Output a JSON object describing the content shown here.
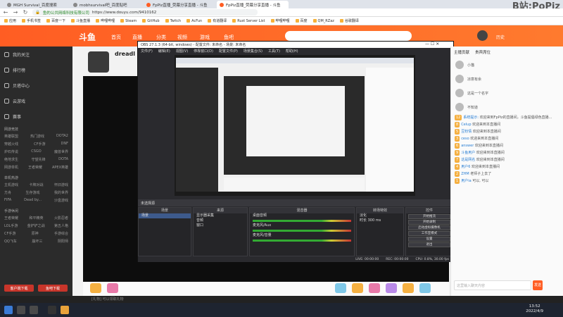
{
  "tabs": [
    {
      "label": "MGH Survival_百度搜索"
    },
    {
      "label": "mobhsurvival吧_百度贴吧"
    },
    {
      "label": "FpPiz直播_荧幕分享直播 - 斗鱼"
    },
    {
      "label": "FpPiz直播_荧幕分享直播 - 斗鱼"
    }
  ],
  "watermark": "B站:PoPiz",
  "address": {
    "lock": "🔒",
    "site_label": "鱼的公共网络科技有限公司",
    "url": "https://www.douyu.com/9410162"
  },
  "bookmarks": [
    "应用",
    "手机书签",
    "百度一下",
    "斗鱼直播",
    "哔哩哔哩",
    "Steam",
    "GitHub",
    "Twitch",
    "AcFun",
    "有道翻译",
    "Rust Server List",
    "哔哩哔哩",
    "百度",
    "QM_RZaz",
    "谷歌翻译"
  ],
  "douyu": {
    "logo": "斗鱼",
    "nav": [
      "首页",
      "直播",
      "分类",
      "视频",
      "游戏",
      "鱼吧"
    ],
    "history": "历史"
  },
  "sidebar": {
    "items": [
      {
        "label": "我的关注"
      },
      {
        "label": "排行榜"
      },
      {
        "label": "贝塔中心"
      },
      {
        "label": "云游戏"
      },
      {
        "label": "赛事"
      }
    ],
    "sections": [
      {
        "title": "网游竞技",
        "rows": [
          [
            "英雄联盟",
            "热门游戏",
            "DOTA2"
          ],
          [
            "穿越火线",
            "CF手游",
            "DNF"
          ],
          [
            "炉石传说",
            "CSGO",
            "魔兽世界"
          ],
          [
            "绝地求生",
            "守望先锋",
            "DOTA"
          ],
          [
            "网游单机",
            "王者荣耀",
            "APEX英雄"
          ]
        ]
      },
      {
        "title": "单机热游",
        "rows": [
          [
            "主机游戏",
            "卡牌对战",
            "怀旧游戏"
          ],
          [
            "方舟",
            "生存游戏",
            "我的世界"
          ],
          [
            "FIFA",
            "Dead by...",
            "沙盒游戏"
          ]
        ]
      },
      {
        "title": "手游休闲",
        "rows": [
          [
            "王者荣耀",
            "和平精英",
            "火影忍者"
          ],
          [
            "LOL手游",
            "金铲铲之战",
            "第五人格"
          ],
          [
            "CF手游",
            "原神",
            "手游综合"
          ],
          [
            "QQ飞车",
            "崩坏三",
            "阴阳师"
          ]
        ]
      }
    ],
    "btn_left": "客户端下载",
    "btn_right": "鱼吧下载"
  },
  "room": {
    "anchor_name": "dreadl",
    "gift_tip": "[礼物] 可以领取礼物"
  },
  "obs": {
    "title": "OBS 27.1.3 (64-bit, windows) - 配置文件: 未命名 - 场景: 未命名",
    "menu": [
      "文件(F)",
      "编辑(E)",
      "视图(V)",
      "停靠窗口(D)",
      "配置文件(P)",
      "场景集合(S)",
      "工具(T)",
      "帮助(H)"
    ],
    "scene_bar": "未选择源",
    "panels": [
      {
        "header": "场景",
        "lines": [
          "场景"
        ]
      },
      {
        "header": "来源",
        "lines": [
          "显示器采集",
          "音频",
          "窗口"
        ]
      },
      {
        "header": "混音器",
        "lines": [
          "桌面音频",
          "麦克风/Aux",
          "麦克风/音量"
        ]
      },
      {
        "header": "转场特效",
        "lines": [
          "淡化",
          "时长  300 ms"
        ]
      },
      {
        "header": "控件",
        "lines": [
          "开始推流",
          "开始录制",
          "启动虚拟摄像机",
          "工作室模式",
          "设置",
          "退出"
        ]
      }
    ],
    "status": [
      "LIVE: 00:00:00",
      "REC: 00:00:00",
      "CPU: 0.8%, 30.00 fps"
    ]
  },
  "chat": {
    "tabs": [
      "主播贡献",
      "贵宾席位"
    ],
    "ranks": [
      {
        "name": "小猫"
      },
      {
        "name": "凉意有余"
      },
      {
        "name": "这是一个名字"
      },
      {
        "name": "不知道"
      }
    ],
    "messages": [
      {
        "lvl": "12",
        "user": "系统提示:",
        "text": "欢迎来到FpPiz的直播间，斗鱼提倡绿色直播..."
      },
      {
        "lvl": "8",
        "user": "Celup",
        "text": "欢迎来到本直播间"
      },
      {
        "lvl": "5",
        "user": "豆粉情",
        "text": "欢迎来到本直播间"
      },
      {
        "lvl": "3",
        "user": "ceso",
        "text": "欢迎来到本直播间"
      },
      {
        "lvl": "6",
        "user": "answer",
        "text": "欢迎来到本直播间"
      },
      {
        "lvl": "9",
        "user": "斗鱼用户",
        "text": "欢迎来到本直播间"
      },
      {
        "lvl": "7",
        "user": "这是网名",
        "text": "欢迎来到本直播间"
      },
      {
        "lvl": "4",
        "user": "用户6",
        "text": "欢迎来到本直播间"
      },
      {
        "lvl": "2",
        "user": "ZHM",
        "text": "老师子上去了"
      },
      {
        "lvl": "1",
        "user": "用户ia",
        "text": "可以, 可以"
      }
    ],
    "input_placeholder": "这里输入聊天内容",
    "send": "发送"
  },
  "clock": {
    "time": "13:52",
    "date": "2022/4/9"
  }
}
